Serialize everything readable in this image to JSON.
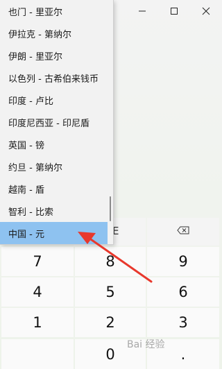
{
  "window": {
    "title_buttons": [
      "minimize-icon",
      "maximize-icon",
      "close-icon"
    ]
  },
  "dropdown": {
    "items": [
      {
        "label": "也门 - 里亚尔"
      },
      {
        "label": "伊拉克 - 第纳尔"
      },
      {
        "label": "伊朗 - 里亚尔"
      },
      {
        "label": "以色列 - 古希伯来钱币"
      },
      {
        "label": "印度 - 卢比"
      },
      {
        "label": "印度尼西亚 - 印尼盾"
      },
      {
        "label": "英国 - 镑"
      },
      {
        "label": "约旦 - 第纳尔"
      },
      {
        "label": "越南 - 盾"
      },
      {
        "label": "智利 - 比索"
      },
      {
        "label": "中国 - 元"
      }
    ],
    "selected_index": 10,
    "selected_color": "#8ec2f0"
  },
  "keypad": {
    "ce_partial": "E",
    "backspace_icon": "backspace-icon",
    "rows": [
      [
        "7",
        "8",
        "9"
      ],
      [
        "4",
        "5",
        "6"
      ],
      [
        "1",
        "2",
        "3"
      ],
      [
        "",
        "0",
        "."
      ]
    ]
  },
  "annotation": {
    "arrow_color": "#e8382c",
    "arrow_icon": "red-arrow-annotation"
  },
  "watermark": {
    "text": "Bai 经验"
  }
}
